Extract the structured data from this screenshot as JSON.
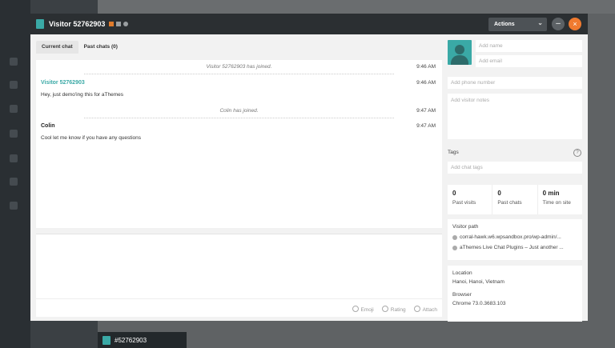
{
  "background": {
    "bottom_item_label": "#52762903"
  },
  "modal": {
    "title": "Visitor 52762903",
    "actions_label": "Actions",
    "minimize_symbol": "–",
    "close_symbol": "×",
    "accent_color": "#f07a2f",
    "visitor_color": "#3aa9a6"
  },
  "tabs": [
    {
      "label": "Current chat",
      "active": true
    },
    {
      "label": "Past chats (0)",
      "active": false
    }
  ],
  "chat": {
    "events": [
      {
        "type": "system",
        "text": "Visitor 52762903 has joined.",
        "time": "9:46 AM"
      },
      {
        "type": "message",
        "author": "Visitor 52762903",
        "role": "visitor",
        "text": "Hey, just demo'ing this for aThemes",
        "time": "9:46 AM"
      },
      {
        "type": "system",
        "text": "Colin has joined.",
        "time": "9:47 AM"
      },
      {
        "type": "message",
        "author": "Colin",
        "role": "agent",
        "text": "Cool let me know if you have any questions",
        "time": "9:47 AM"
      }
    ]
  },
  "composer": {
    "emoji_label": "Emoji",
    "rating_label": "Rating",
    "attach_label": "Attach"
  },
  "visitor": {
    "name_placeholder": "Add name",
    "email_placeholder": "Add email",
    "phone_placeholder": "Add phone number",
    "notes_placeholder": "Add visitor notes",
    "tags_label": "Tags",
    "tags_placeholder": "Add chat tags",
    "help_symbol": "?",
    "stats": [
      {
        "value": "0",
        "label": "Past visits"
      },
      {
        "value": "0",
        "label": "Past chats"
      },
      {
        "value": "0 min",
        "label": "Time on site"
      }
    ],
    "path_title": "Visitor path",
    "path": [
      "corral-hawk.w6.wpsandbox.pro/wp-admin/...",
      "aThemes Live Chat Plugins – Just another ..."
    ],
    "location_label": "Location",
    "location_value": "Hanoi, Hanoi, Vietnam",
    "browser_label": "Browser",
    "browser_value": "Chrome 73.0.3683.103"
  }
}
